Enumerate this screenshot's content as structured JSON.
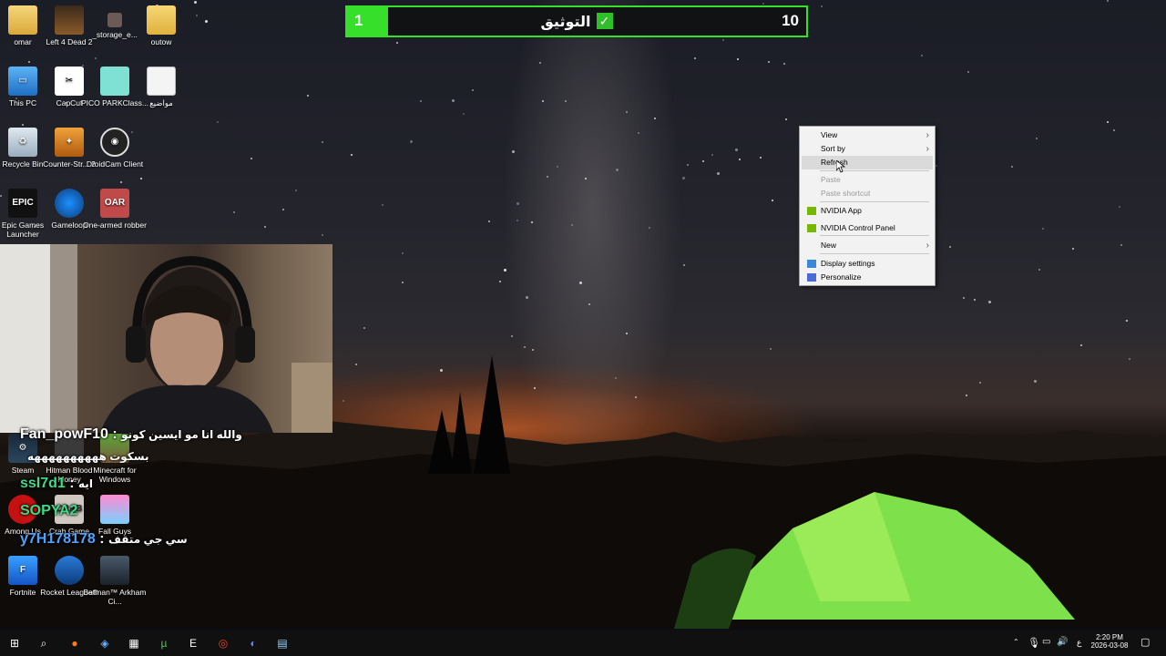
{
  "top_bar": {
    "left_value": "1",
    "title": "التوثيق",
    "right_value": "10",
    "progress_fraction": 0.09,
    "accent": "#36e02a"
  },
  "desktop_icons": [
    {
      "label": "omar",
      "icon": "user-folder-icon"
    },
    {
      "label": "Left 4 Dead 2",
      "icon": "left4dead-icon"
    },
    {
      "label": "_storage_e...",
      "icon": "storage-icon"
    },
    {
      "label": "outow",
      "icon": "folder-icon"
    },
    {
      "label": "This PC",
      "icon": "this-pc-icon"
    },
    {
      "label": "CapCut",
      "icon": "capcut-icon"
    },
    {
      "label": "PICO PARKClass...",
      "icon": "pico-park-icon"
    },
    {
      "label": "مواضيع",
      "icon": "document-icon"
    },
    {
      "label": "Recycle Bin",
      "icon": "recycle-bin-icon"
    },
    {
      "label": "Counter-Str... 2",
      "icon": "counter-strike-icon"
    },
    {
      "label": "DroidCam Client",
      "icon": "droidcam-icon"
    },
    {
      "label": "Epic Games Launcher",
      "icon": "epic-games-icon"
    },
    {
      "label": "Gameloop",
      "icon": "gameloop-icon"
    },
    {
      "label": "One-armed robber",
      "icon": "one-armed-robber-icon"
    },
    {
      "label": "Steam",
      "icon": "steam-icon"
    },
    {
      "label": "Hitman Blood Money",
      "icon": "hitman-icon"
    },
    {
      "label": "Minecraft for Windows",
      "icon": "minecraft-icon"
    },
    {
      "label": "Among Us",
      "icon": "among-us-icon"
    },
    {
      "label": "Crab Game",
      "icon": "crab-game-icon"
    },
    {
      "label": "Fall Guys",
      "icon": "fall-guys-icon"
    },
    {
      "label": "Fortnite",
      "icon": "fortnite-icon"
    },
    {
      "label": "Rocket League®",
      "icon": "rocket-league-icon"
    },
    {
      "label": "Batman™ Arkham Ci...",
      "icon": "batman-icon"
    }
  ],
  "chat": [
    {
      "user": "Fan_powF10",
      "message": "والله انا مو ايسين كونو",
      "user_color": "#ffffff"
    },
    {
      "user": "",
      "message": "بسكوت ههههههههههه",
      "user_color": "#ffffff"
    },
    {
      "user": "ssl7d1",
      "message": "ايه",
      "user_color": "#3ddc84"
    },
    {
      "user": "SOPYA2",
      "message": "",
      "user_color": "#3ddc84"
    },
    {
      "user": "y7H178178",
      "message": "سي جي متقف",
      "user_color": "#4da3ff"
    }
  ],
  "context_menu": {
    "items": [
      {
        "label": "View",
        "submenu": true,
        "disabled": false
      },
      {
        "label": "Sort by",
        "submenu": true,
        "disabled": false
      },
      {
        "label": "Refresh",
        "submenu": false,
        "disabled": false
      },
      {
        "label": "Paste",
        "submenu": false,
        "disabled": true
      },
      {
        "label": "Paste shortcut",
        "submenu": false,
        "disabled": true
      },
      {
        "label": "NVIDIA App",
        "submenu": false,
        "disabled": false
      },
      {
        "label": "NVIDIA Control Panel",
        "submenu": false,
        "disabled": false
      },
      {
        "label": "New",
        "submenu": true,
        "disabled": false
      },
      {
        "label": "Display settings",
        "submenu": false,
        "disabled": false
      },
      {
        "label": "Personalize",
        "submenu": false,
        "disabled": false
      }
    ],
    "highlighted": "Refresh"
  },
  "taskbar": {
    "apps": [
      "start-icon",
      "search-icon",
      "firefox-icon",
      "copilot-icon",
      "store-icon",
      "utorrent-icon",
      "epic-games-icon",
      "chrome-icon",
      "discord-icon",
      "file-icon"
    ],
    "language": "ع",
    "time": "2:20 PM",
    "date": "2026-03-08"
  }
}
